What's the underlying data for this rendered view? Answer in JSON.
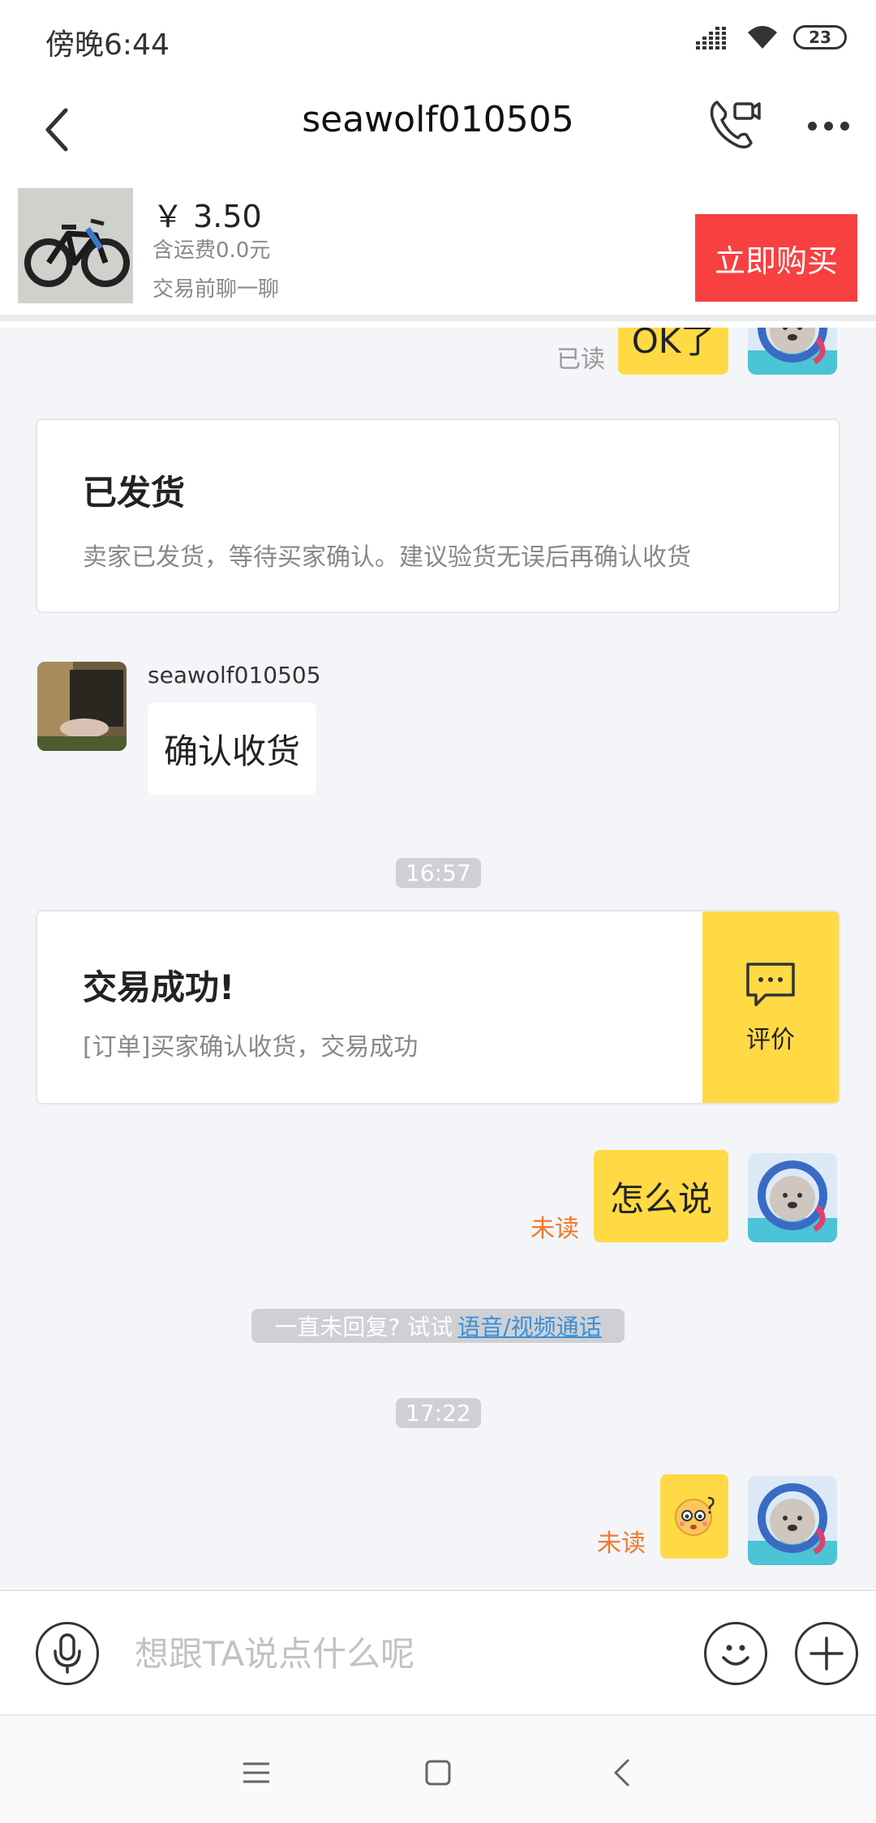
{
  "status_bar": {
    "time": "傍晚6:44",
    "battery": "23"
  },
  "nav": {
    "title": "seawolf010505"
  },
  "product": {
    "price": "￥ 3.50",
    "shipping": "含运费0.0元",
    "note": "交易前聊一聊",
    "buy_label": "立即购买"
  },
  "messages": {
    "top_partial": {
      "text": "OK了",
      "read_state": "已读"
    },
    "shipped_card": {
      "title": "已发货",
      "desc": "卖家已发货，等待买家确认。建议验货无误后再确认收货"
    },
    "seller_msg": {
      "sender": "seawolf010505",
      "text": "确认收货"
    },
    "time1": "16:57",
    "success_card": {
      "title": "交易成功!",
      "desc": "[订单]买家确认收货，交易成功",
      "review_label": "评价"
    },
    "my_msg1": {
      "text": "怎么说",
      "read_state": "未读"
    },
    "hint": {
      "text": "一直未回复? 试试",
      "link": "语音/视频通话"
    },
    "time2": "17:22",
    "my_msg2": {
      "read_state": "未读",
      "emoji": "confused-face"
    }
  },
  "input": {
    "placeholder": "想跟TA说点什么呢"
  },
  "colors": {
    "accent_yellow": "#ffda44",
    "buy_red": "#f94040",
    "unread_orange": "#f0782c",
    "link_blue": "#3a8fd8",
    "chat_bg": "#f4f5f9"
  }
}
